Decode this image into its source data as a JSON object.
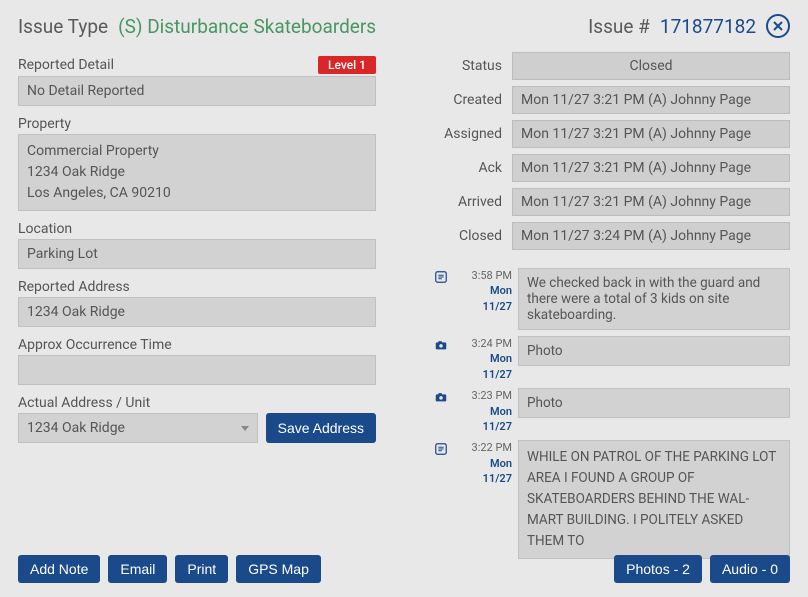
{
  "header": {
    "issue_type_label": "Issue Type",
    "issue_type_value": "(S) Disturbance Skateboarders",
    "issue_number_label": "Issue #",
    "issue_number_value": "171877182"
  },
  "left": {
    "reported_detail_label": "Reported Detail",
    "level_badge": "Level 1",
    "reported_detail_value": "No Detail Reported",
    "property_label": "Property",
    "property_value": "Commercial Property\n1234 Oak Ridge\nLos Angeles, CA 90210",
    "location_label": "Location",
    "location_value": "Parking Lot",
    "reported_address_label": "Reported Address",
    "reported_address_value": "1234 Oak Ridge",
    "approx_time_label": "Approx Occurrence Time",
    "approx_time_value": "",
    "actual_address_label": "Actual Address / Unit",
    "actual_address_value": "1234 Oak Ridge",
    "save_address_label": "Save Address"
  },
  "right": {
    "status_rows": {
      "status": {
        "label": "Status",
        "value": "Closed"
      },
      "created": {
        "label": "Created",
        "value": "Mon 11/27  3:21 PM (A) Johnny Page"
      },
      "assigned": {
        "label": "Assigned",
        "value": "Mon 11/27  3:21 PM (A) Johnny Page"
      },
      "ack": {
        "label": "Ack",
        "value": "Mon 11/27  3:21 PM (A) Johnny Page"
      },
      "arrived": {
        "label": "Arrived",
        "value": "Mon 11/27  3:21 PM (A) Johnny Page"
      },
      "closed": {
        "label": "Closed",
        "value": "Mon 11/27  3:24 PM (A) Johnny Page"
      }
    },
    "timeline": [
      {
        "icon": "note",
        "time": "3:58 PM",
        "day": "Mon",
        "date": "11/27",
        "content": "We checked back in with the guard and there were a total of 3 kids on site skateboarding."
      },
      {
        "icon": "photo",
        "time": "3:24 PM",
        "day": "Mon",
        "date": "11/27",
        "content": "Photo"
      },
      {
        "icon": "photo",
        "time": "3:23 PM",
        "day": "Mon",
        "date": "11/27",
        "content": "Photo"
      },
      {
        "icon": "note",
        "time": "3:22 PM",
        "day": "Mon",
        "date": "11/27",
        "content": "WHILE ON PATROL OF THE PARKING LOT AREA I FOUND A GROUP OF SKATEBOARDERS BEHIND THE WAL-MART BUILDING. I POLITELY ASKED THEM TO"
      }
    ]
  },
  "footer": {
    "add_note": "Add Note",
    "email": "Email",
    "print": "Print",
    "gps_map": "GPS Map",
    "photos": "Photos - 2",
    "audio": "Audio - 0"
  }
}
